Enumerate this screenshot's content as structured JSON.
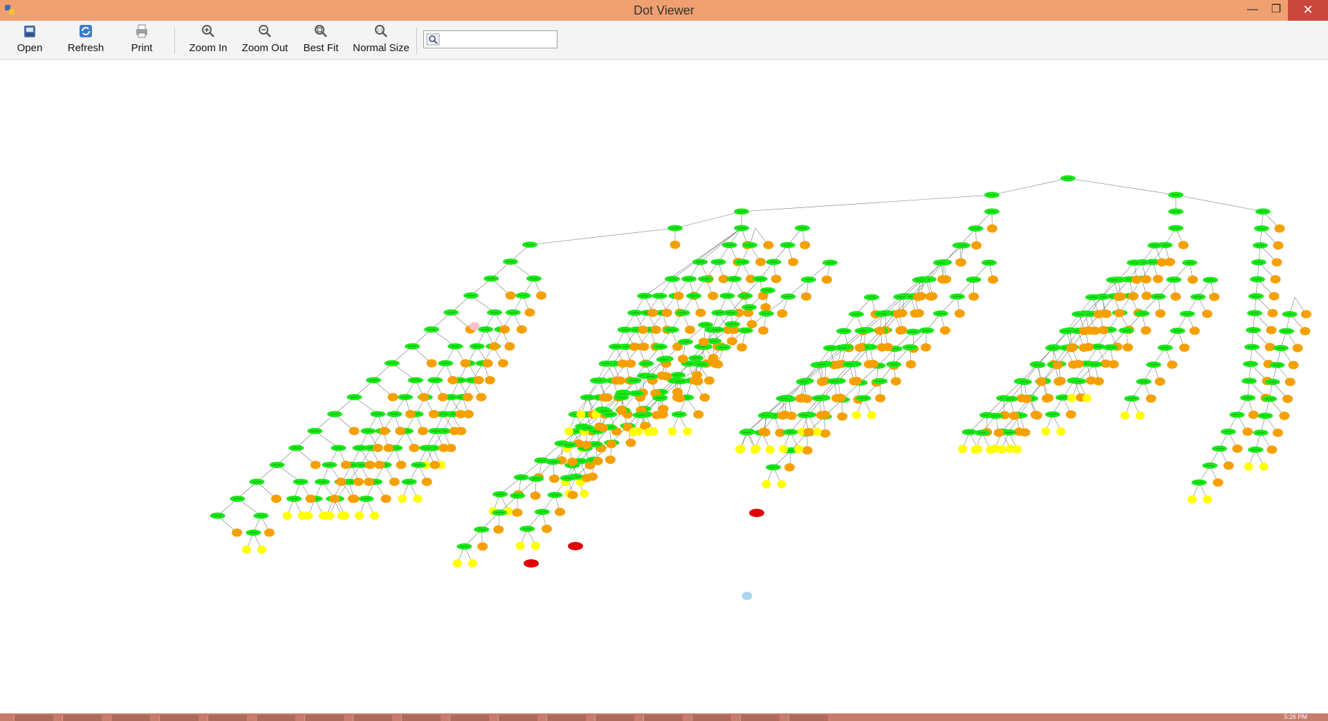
{
  "window": {
    "title": "Dot Viewer",
    "minimize": "—",
    "maximize": "❐",
    "close": "✕"
  },
  "toolbar": {
    "open_label": "Open",
    "refresh_label": "Refresh",
    "print_label": "Print",
    "zoom_in_label": "Zoom In",
    "zoom_out_label": "Zoom Out",
    "best_fit_label": "Best Fit",
    "normal_size_label": "Normal Size",
    "search_value": ""
  },
  "graph": {
    "description_colors": {
      "internal": "#18e818",
      "leaf": "#f5a000",
      "terminal": "#ffff00",
      "error": "#e00000",
      "highlight_pink": "#ffc0c8",
      "highlight_blue": "#a8d8f0",
      "edge": "#777777"
    }
  },
  "taskbar": {
    "clock": "5:26 PM"
  }
}
